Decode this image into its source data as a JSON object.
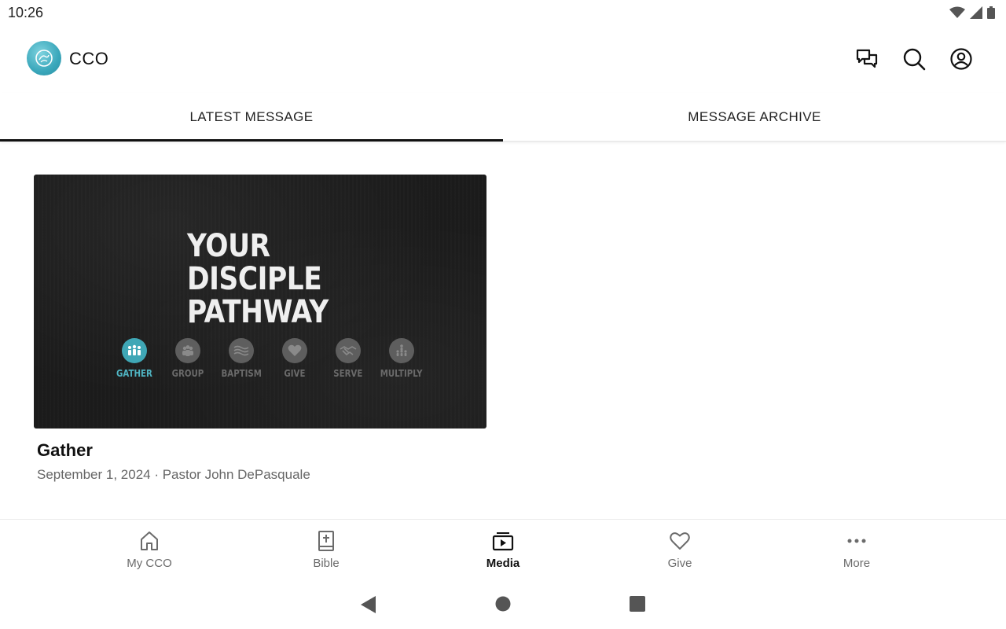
{
  "status_bar": {
    "time": "10:26",
    "icons": [
      "wifi-icon",
      "signal-icon",
      "battery-icon"
    ]
  },
  "header": {
    "app_title": "CCO",
    "actions": [
      "chat-icon",
      "search-icon",
      "account-icon"
    ]
  },
  "tabs": [
    {
      "label": "LATEST MESSAGE",
      "active": true
    },
    {
      "label": "MESSAGE ARCHIVE",
      "active": false
    }
  ],
  "message": {
    "thumbnail": {
      "title_lines": [
        "YOUR",
        "DISCIPLE",
        "PATHWAY"
      ],
      "steps": [
        {
          "label": "GATHER",
          "active": true
        },
        {
          "label": "GROUP",
          "active": false
        },
        {
          "label": "BAPTISM",
          "active": false
        },
        {
          "label": "GIVE",
          "active": false
        },
        {
          "label": "SERVE",
          "active": false
        },
        {
          "label": "MULTIPLY",
          "active": false
        }
      ]
    },
    "title": "Gather",
    "meta": "September 1, 2024 · Pastor John DePasquale"
  },
  "bottom_nav": [
    {
      "label": "My CCO",
      "icon": "home-icon",
      "active": false
    },
    {
      "label": "Bible",
      "icon": "bible-icon",
      "active": false
    },
    {
      "label": "Media",
      "icon": "media-icon",
      "active": true
    },
    {
      "label": "Give",
      "icon": "heart-icon",
      "active": false
    },
    {
      "label": "More",
      "icon": "more-icon",
      "active": false
    }
  ],
  "colors": {
    "accent": "#3fa7b6",
    "logo": "#3aa7bb",
    "thumbnail_bg": "#1b1b1b"
  }
}
